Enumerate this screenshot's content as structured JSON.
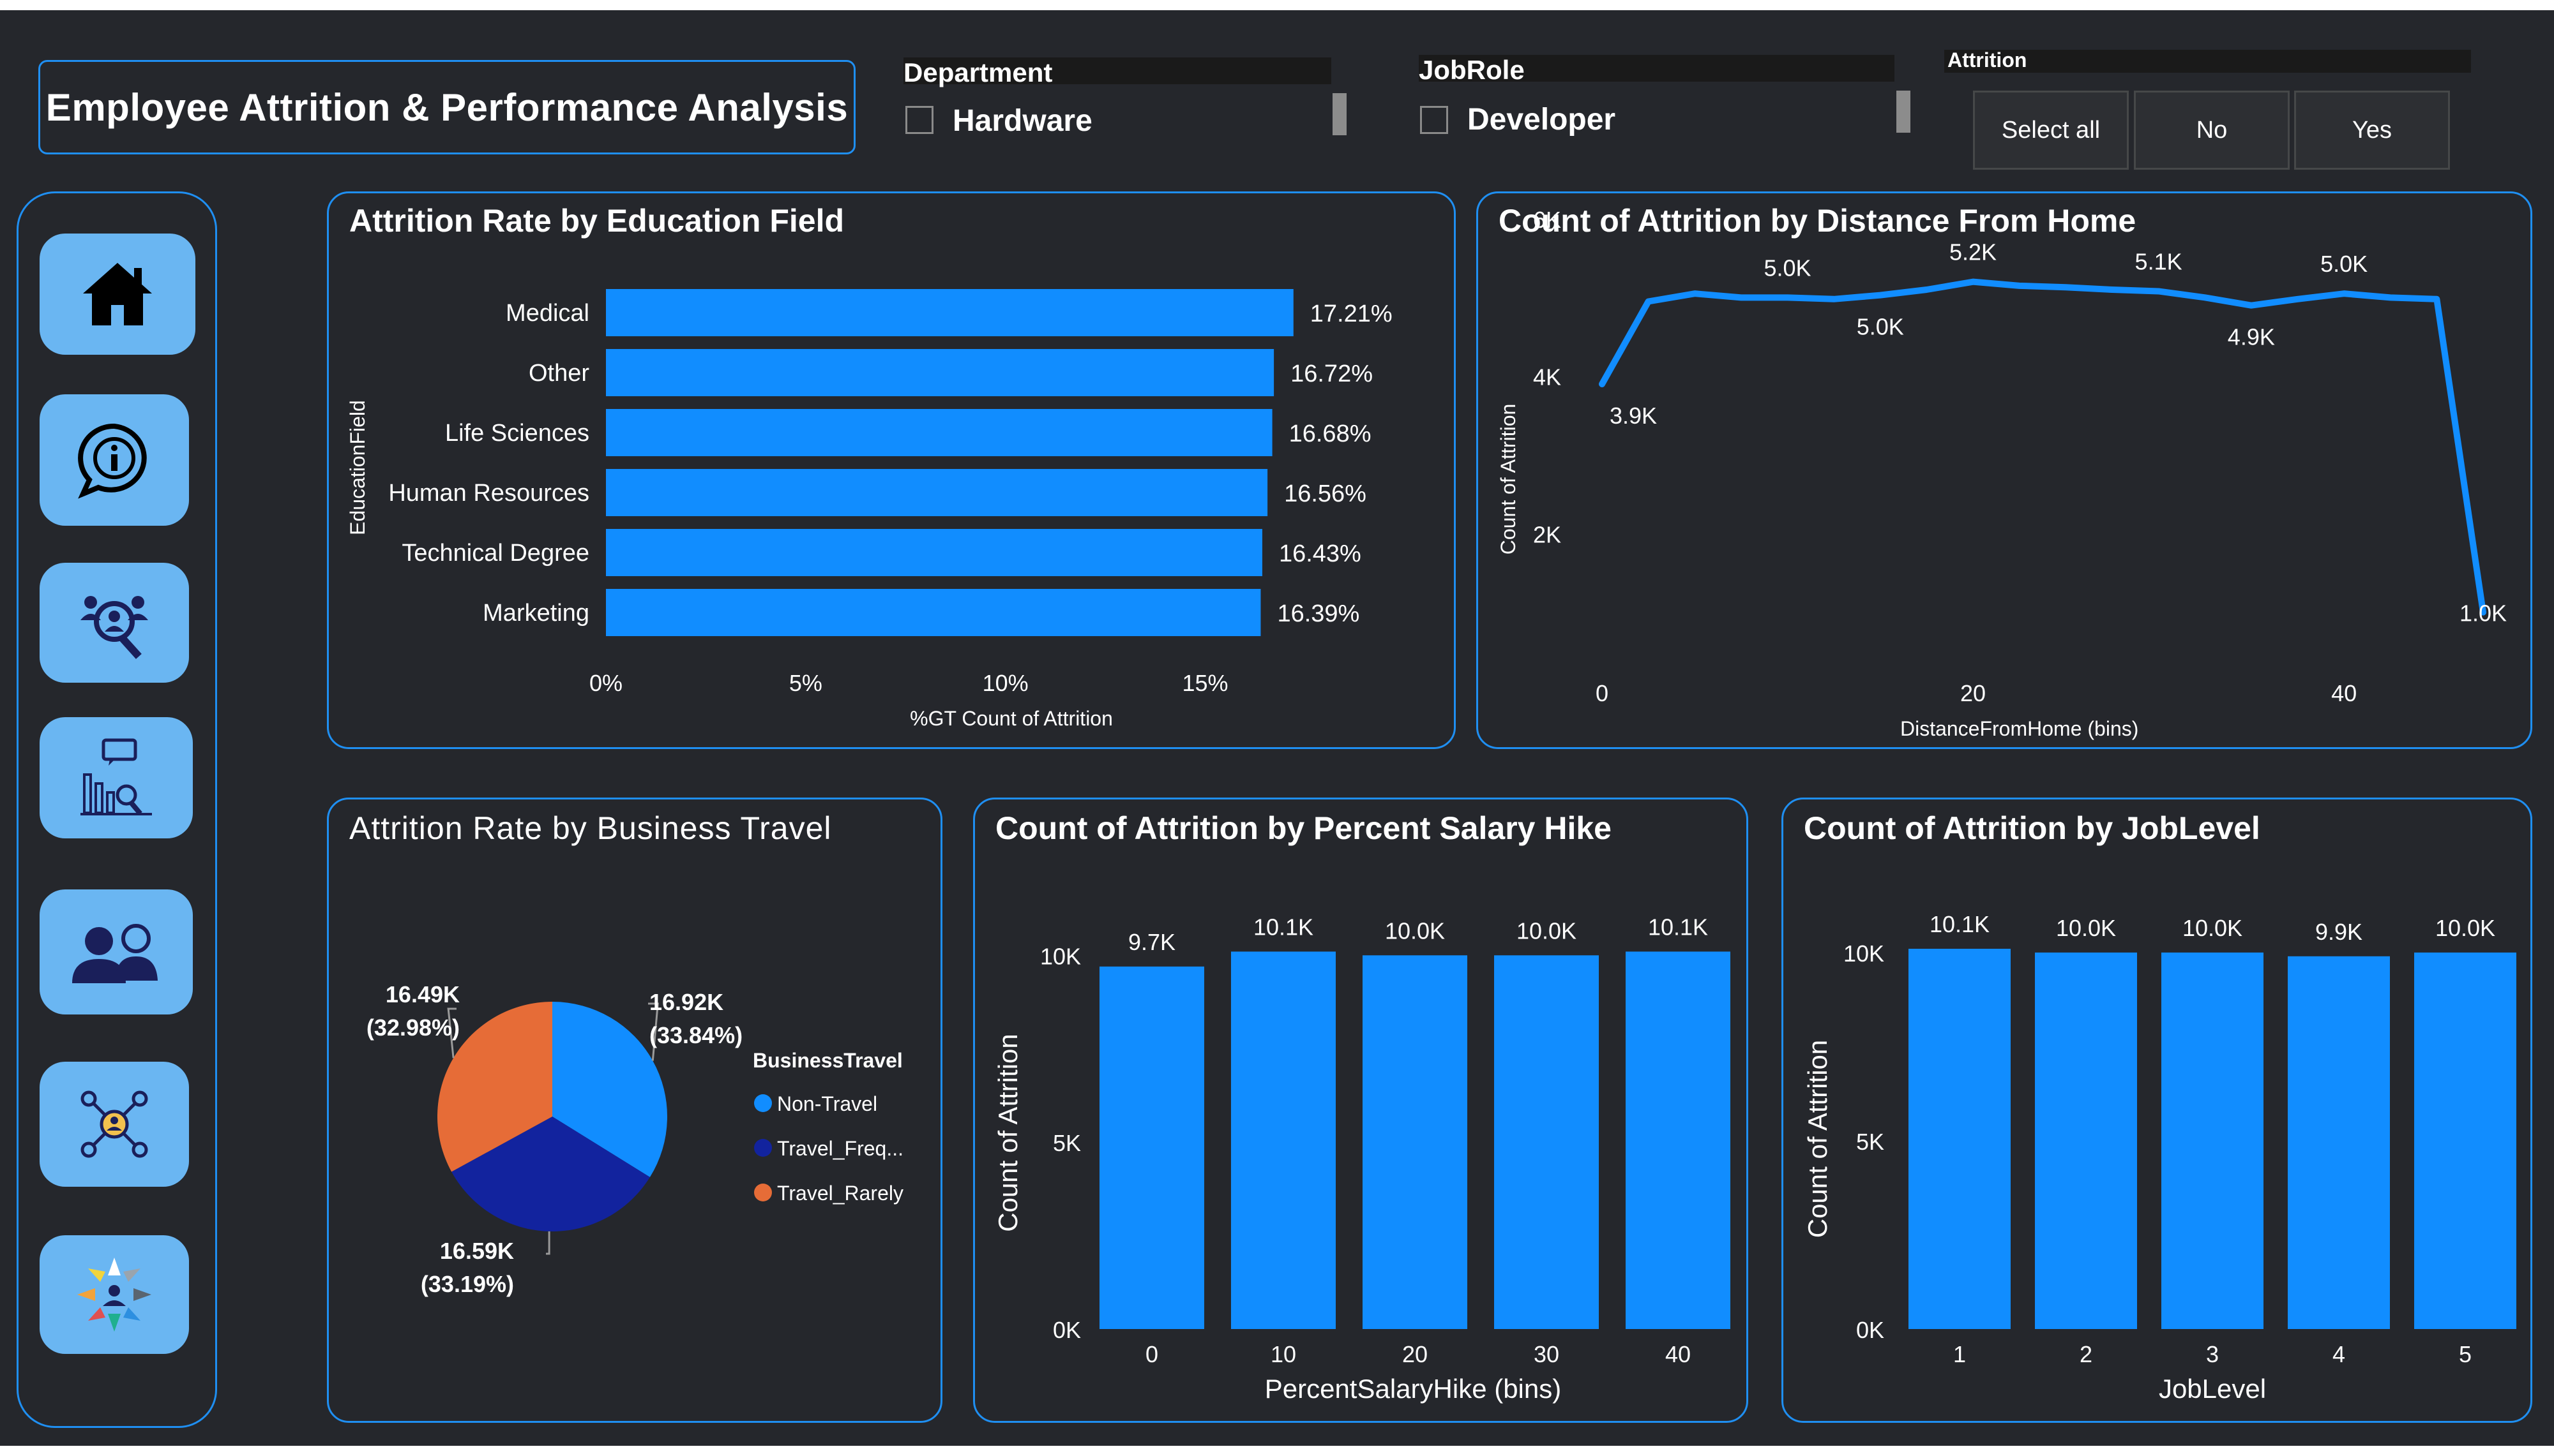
{
  "header": {
    "title": "Employee Attrition & Performance Analysis",
    "department": {
      "label": "Department",
      "value": "Hardware"
    },
    "jobrole": {
      "label": "JobRole",
      "value": "Developer"
    },
    "attrition": {
      "label": "Attrition",
      "options": [
        "Select all",
        "No",
        "Yes"
      ]
    }
  },
  "sidebar": {
    "items": [
      {
        "icon": "home-icon"
      },
      {
        "icon": "info-icon"
      },
      {
        "icon": "people-search-icon"
      },
      {
        "icon": "analytics-report-icon"
      },
      {
        "icon": "employees-icon"
      },
      {
        "icon": "network-icon"
      },
      {
        "icon": "team-wheel-icon"
      }
    ]
  },
  "colors": {
    "background": "#25272c",
    "accent": "#1f8ff2",
    "bar": "#118dff",
    "navy": "#12239e",
    "orange": "#e66c37",
    "nav_button": "#6ab6f2"
  },
  "chart_data": [
    {
      "id": "education",
      "type": "bar",
      "orientation": "horizontal",
      "title": "Attrition Rate by Education Field",
      "xlabel": "%GT Count of Attrition",
      "ylabel": "EducationField",
      "categories": [
        "Medical",
        "Other",
        "Life Sciences",
        "Human Resources",
        "Technical Degree",
        "Marketing"
      ],
      "values": [
        17.21,
        16.72,
        16.68,
        16.56,
        16.43,
        16.39
      ],
      "value_labels": [
        "17.21%",
        "16.72%",
        "16.68%",
        "16.56%",
        "16.43%",
        "16.39%"
      ],
      "xlim": [
        0,
        18.7
      ],
      "xticks": [
        "0%",
        "5%",
        "10%",
        "15%"
      ]
    },
    {
      "id": "distance",
      "type": "line",
      "title": "Count of Attrition by Distance From Home",
      "xlabel": "DistanceFromHome (bins)",
      "ylabel": "Count of Attrition",
      "x": [
        0,
        2.5,
        5,
        7.5,
        10,
        12.5,
        15,
        17.5,
        20,
        22.5,
        25,
        27.5,
        30,
        32.5,
        35,
        37.5,
        40,
        42.5,
        45,
        47.5
      ],
      "y": [
        3900,
        4950,
        5050,
        5000,
        5000,
        4980,
        5030,
        5100,
        5200,
        5150,
        5130,
        5100,
        5080,
        5000,
        4900,
        4980,
        5050,
        5000,
        4980,
        1000
      ],
      "point_labels": [
        {
          "index": 0,
          "text": "3.9K",
          "pos": "below"
        },
        {
          "index": 4,
          "text": "5.0K",
          "pos": "above"
        },
        {
          "index": 6,
          "text": "5.0K",
          "pos": "below"
        },
        {
          "index": 8,
          "text": "5.2K",
          "pos": "above"
        },
        {
          "index": 12,
          "text": "5.1K",
          "pos": "above"
        },
        {
          "index": 14,
          "text": "4.9K",
          "pos": "below"
        },
        {
          "index": 16,
          "text": "5.0K",
          "pos": "above"
        },
        {
          "index": 19,
          "text": "1.0K",
          "pos": "on"
        }
      ],
      "xlim": [
        0,
        47.5
      ],
      "ylim": [
        0,
        6000
      ],
      "yticks": [
        {
          "v": 2000,
          "t": "2K"
        },
        {
          "v": 4000,
          "t": "4K"
        },
        {
          "v": 6000,
          "t": "6K"
        }
      ],
      "xticks": [
        {
          "v": 0,
          "t": "0"
        },
        {
          "v": 20,
          "t": "20"
        },
        {
          "v": 40,
          "t": "40"
        }
      ]
    },
    {
      "id": "travel",
      "type": "pie",
      "title": "Attrition Rate by Business Travel",
      "legend_title": "BusinessTravel",
      "slices": [
        {
          "name": "Non-Travel",
          "value": 16920,
          "label": "16.92K",
          "pct": "(33.84%)",
          "color": "#118dff"
        },
        {
          "name": "Travel_Freq...",
          "value": 16590,
          "label": "16.59K",
          "pct": "(33.19%)",
          "color": "#12239e"
        },
        {
          "name": "Travel_Rarely",
          "value": 16490,
          "label": "16.49K",
          "pct": "(32.98%)",
          "color": "#e66c37"
        }
      ]
    },
    {
      "id": "salary",
      "type": "bar",
      "title": "Count of Attrition by Percent Salary Hike",
      "xlabel": "PercentSalaryHike (bins)",
      "ylabel": "Count of Attrition",
      "categories": [
        "0",
        "10",
        "20",
        "30",
        "40"
      ],
      "values": [
        9700,
        10100,
        10000,
        10000,
        10100
      ],
      "value_labels": [
        "9.7K",
        "10.1K",
        "10.0K",
        "10.0K",
        "10.1K"
      ],
      "ylim": [
        0,
        10500
      ],
      "yticks": [
        {
          "v": 0,
          "t": "0K"
        },
        {
          "v": 5000,
          "t": "5K"
        },
        {
          "v": 10000,
          "t": "10K"
        }
      ]
    },
    {
      "id": "joblevel",
      "type": "bar",
      "title": "Count of Attrition by JobLevel",
      "xlabel": "JobLevel",
      "ylabel": "Count of Attrition",
      "categories": [
        "1",
        "2",
        "3",
        "4",
        "5"
      ],
      "values": [
        10100,
        10000,
        10000,
        9900,
        10000
      ],
      "value_labels": [
        "10.1K",
        "10.0K",
        "10.0K",
        "9.9K",
        "10.0K"
      ],
      "ylim": [
        0,
        10100
      ],
      "yticks": [
        {
          "v": 0,
          "t": "0K"
        },
        {
          "v": 5000,
          "t": "5K"
        },
        {
          "v": 10000,
          "t": "10K"
        }
      ]
    }
  ]
}
